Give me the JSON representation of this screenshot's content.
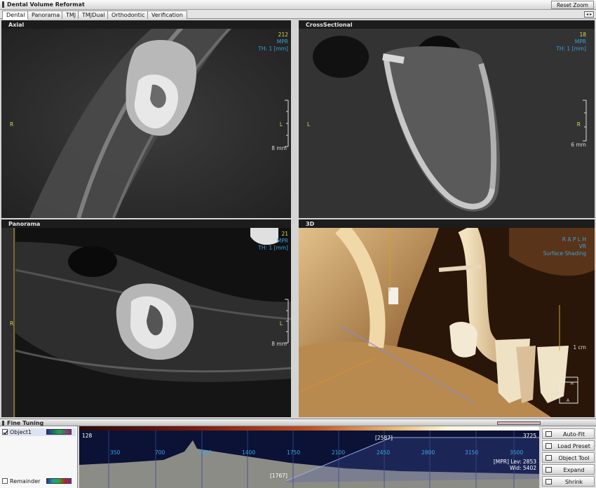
{
  "window": {
    "title": "Dental Volume Reformat",
    "reset_zoom": "Reset Zoom",
    "tab_ctrl": "◂ ▸"
  },
  "tabs": [
    "Dental",
    "Panorama",
    "TMJ",
    "TMJDual",
    "Orthodontic",
    "Verification"
  ],
  "viewports": {
    "axial": {
      "title": "Axial",
      "slice": "212",
      "mode": "MPR",
      "thickness": "TH: 1 [mm]",
      "left_label": "R",
      "right_label": "L",
      "scale": "8 mm"
    },
    "cross": {
      "title": "CrossSectional",
      "slice": "18",
      "mode": "MPR",
      "thickness": "TH: 1 [mm]",
      "left_label": "L",
      "right_label": "R",
      "scale": "6 mm"
    },
    "panorama": {
      "title": "Panorama",
      "slice": "21",
      "mode": "MPR",
      "thickness": "TH: 1 [mm]",
      "left_label": "R",
      "right_label": "L",
      "scale": "8 mm"
    },
    "threed": {
      "title": "3D",
      "orient": "R A P L H",
      "mode": "VR",
      "render": "Surface Shading",
      "scale": "1 cm",
      "cube_h": "H",
      "cube_r": "R",
      "cube_a": "A"
    }
  },
  "fine_tuning": {
    "title": "Fine Tuning",
    "objects": [
      {
        "name": "Object1",
        "checked": true
      },
      {
        "name": "Remainder",
        "checked": false
      }
    ],
    "range_min": "128",
    "range_max": "3725",
    "ticks": [
      "350",
      "700",
      "1050",
      "1400",
      "1750",
      "2100",
      "2450",
      "2800",
      "3150",
      "3500"
    ],
    "marker_low": "[1767]",
    "marker_high": "[2587]",
    "mpr_lev": "[MPR] Lev:  2853",
    "mpr_wid": "Wid:  5402",
    "buttons": [
      "Auto-Fit",
      "Load Preset",
      "Object Tool",
      "Expand",
      "Shrink"
    ]
  },
  "colors": {
    "overlay_yellow": "#e0d84a",
    "overlay_blue": "#3a9fd6",
    "tf_background": "#0b1236",
    "bone": "#c89a60"
  }
}
